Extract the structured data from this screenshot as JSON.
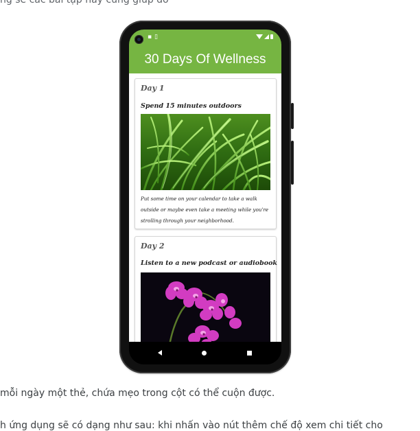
{
  "captions": {
    "top": "ng sẽ các bài tập này cũng giúp đỡ",
    "bottom": "mỗi ngày một thẻ, chứa mẹo trong cột có thể cuộn được.",
    "bottom2": "h ứng dụng sẽ có dạng như sau: khi nhấn vào nút thêm chế độ xem chi tiết cho"
  },
  "app": {
    "title": "30 Days Of Wellness",
    "accent": "#76b542"
  },
  "status_bar": {
    "icons": [
      "lock-icon",
      "sim-icon",
      "wifi-icon",
      "signal-icon",
      "battery-icon"
    ]
  },
  "cards": [
    {
      "day": "Day 1",
      "title": "Spend 15 minutes outdoors",
      "image": "grass-image",
      "description": "Put some time on your calendar to take a walk outside or maybe even take a meeting while you're strolling through your neighborhood."
    },
    {
      "day": "Day 2",
      "title": "Listen to a new podcast or audiobook",
      "image": "orchid-image"
    }
  ],
  "nav_bar": {
    "buttons": [
      "back-icon",
      "home-icon",
      "recents-icon"
    ]
  }
}
